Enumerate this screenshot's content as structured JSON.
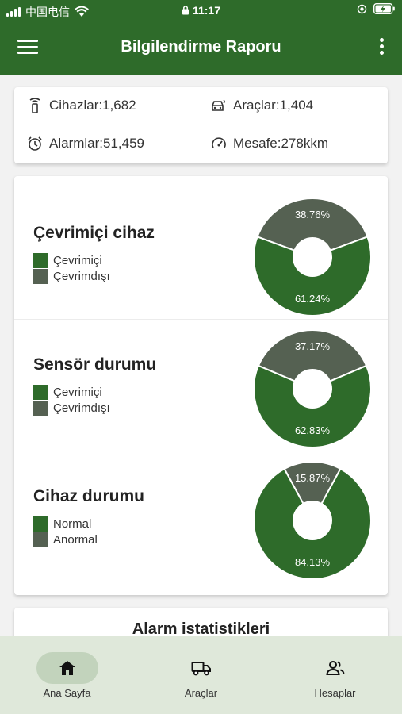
{
  "status_bar": {
    "carrier": "中国电信",
    "time": "11:17"
  },
  "app_bar": {
    "title": "Bilgilendirme Raporu"
  },
  "summary": {
    "devices": "Cihazlar:1,682",
    "vehicles": "Araçlar:1,404",
    "alarms": "Alarmlar:51,459",
    "distance": "Mesafe:278kkm"
  },
  "colors": {
    "primary": "#2e6b2a",
    "secondary": "#556152",
    "nav_bg": "#dfe8da",
    "nav_active": "#c2d3bc"
  },
  "chart_data": [
    {
      "type": "pie",
      "title": "Çevrimiçi cihaz",
      "categories": [
        "Çevrimiçi",
        "Çevrimdışı"
      ],
      "values": [
        61.24,
        38.76
      ],
      "labels": [
        "61.24%",
        "38.76%"
      ],
      "colors": [
        "#2e6b2a",
        "#556152"
      ]
    },
    {
      "type": "pie",
      "title": "Sensör durumu",
      "categories": [
        "Çevrimiçi",
        "Çevrimdışı"
      ],
      "values": [
        62.83,
        37.17
      ],
      "labels": [
        "62.83%",
        "37.17%"
      ],
      "colors": [
        "#2e6b2a",
        "#556152"
      ]
    },
    {
      "type": "pie",
      "title": "Cihaz durumu",
      "categories": [
        "Normal",
        "Anormal"
      ],
      "values": [
        84.13,
        15.87
      ],
      "labels": [
        "84.13%",
        "15.87%"
      ],
      "colors": [
        "#2e6b2a",
        "#556152"
      ]
    }
  ],
  "alarm_section": {
    "title": "Alarm istatistikleri"
  },
  "bottom_nav": [
    {
      "label": "Ana Sayfa",
      "icon": "home-icon",
      "active": true
    },
    {
      "label": "Araçlar",
      "icon": "truck-icon",
      "active": false
    },
    {
      "label": "Hesaplar",
      "icon": "accounts-icon",
      "active": false
    }
  ]
}
